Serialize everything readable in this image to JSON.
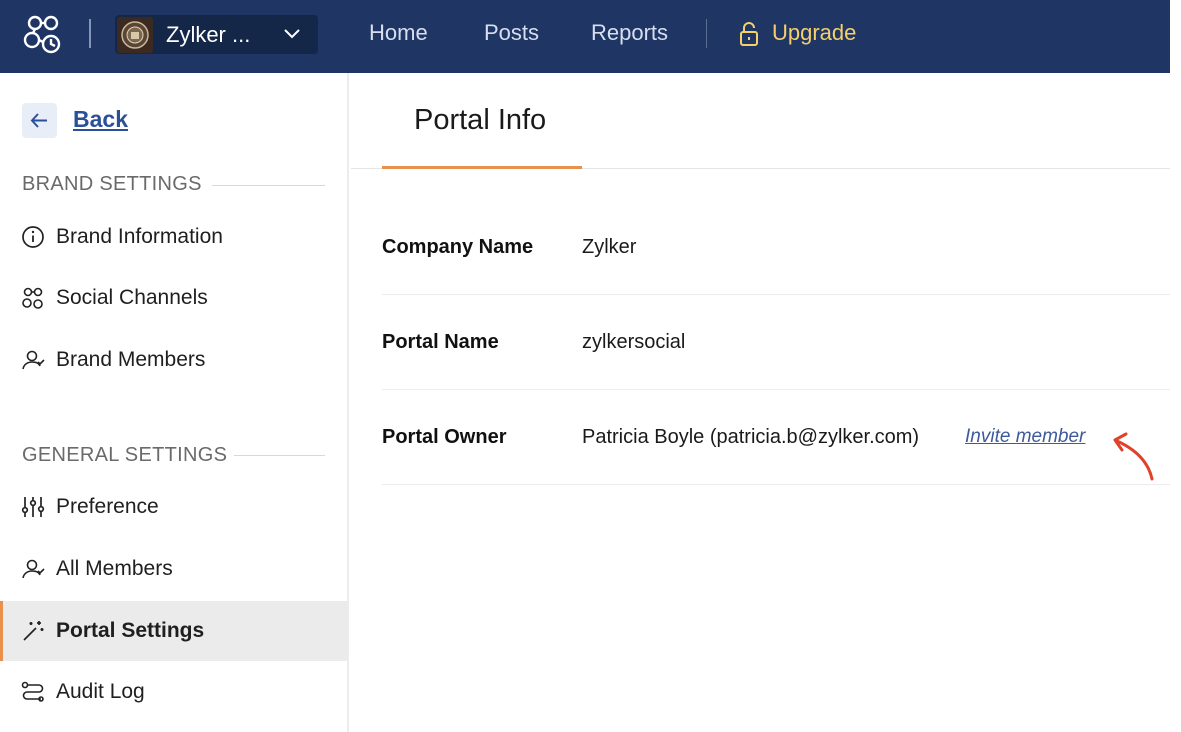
{
  "topbar": {
    "brand_name": "Zylker ...",
    "nav": {
      "home": "Home",
      "posts": "Posts",
      "reports": "Reports",
      "upgrade": "Upgrade"
    }
  },
  "sidebar": {
    "back_label": "Back",
    "brand_settings": {
      "title": "BRAND SETTINGS",
      "items": [
        {
          "label": "Brand Information",
          "icon": "info-icon"
        },
        {
          "label": "Social Channels",
          "icon": "social-channels-icon"
        },
        {
          "label": "Brand Members",
          "icon": "members-icon"
        }
      ]
    },
    "general_settings": {
      "title": "GENERAL SETTINGS",
      "items": [
        {
          "label": "Preference",
          "icon": "sliders-icon"
        },
        {
          "label": "All Members",
          "icon": "members-icon"
        },
        {
          "label": "Portal Settings",
          "icon": "magic-wand-icon",
          "active": true
        },
        {
          "label": "Audit Log",
          "icon": "audit-log-icon"
        }
      ]
    }
  },
  "main": {
    "tab_label": "Portal Info",
    "rows": [
      {
        "key": "Company Name",
        "value": "Zylker"
      },
      {
        "key": "Portal Name",
        "value": "zylkersocial"
      },
      {
        "key": "Portal Owner",
        "value": "Patricia Boyle (patricia.b@zylker.com)",
        "action": "Invite member"
      }
    ]
  },
  "colors": {
    "topbar_bg": "#1f3564",
    "accent_orange": "#e8904e",
    "upgrade_gold": "#f5cf6a",
    "link_blue": "#2c4f9a",
    "annotation_red": "#e0412b"
  }
}
